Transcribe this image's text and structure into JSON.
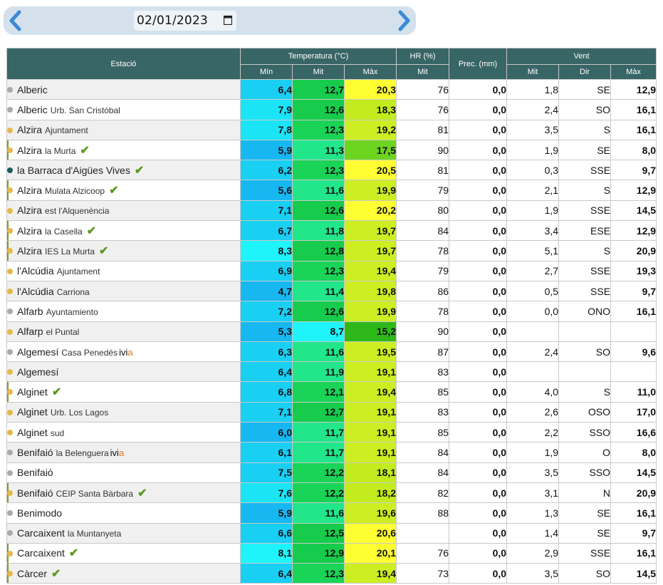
{
  "date": {
    "value": "02/01/2023"
  },
  "colors": {
    "header": "#386565",
    "dot_yellow": "#e6b84a",
    "dot_gray": "#aaaaaa",
    "dot_teal": "#1a5c5c",
    "check": "#5a9a1e",
    "ivia_a": "#e07a20"
  },
  "headers": {
    "estacio": "Estació",
    "temperatura": "Temperatura (°C)",
    "hr": "HR (%)",
    "prec": "Prec. (mm)",
    "vent": "Vent",
    "tmin": "Mín",
    "tmit": "Mit",
    "tmax": "Màx",
    "hrmit": "Mit",
    "vmit": "Mit",
    "vdir": "Dir",
    "vmax": "Màx"
  },
  "rows": [
    {
      "name": "Alberic",
      "sub": "",
      "dot": "gray",
      "check": false,
      "ivia": false,
      "flag": false,
      "tmin": "6,4",
      "tmit": "12,7",
      "tmax": "20,3",
      "hr": "76",
      "prec": "0,0",
      "vmit": "1,8",
      "dir": "SE",
      "vmax": "12,9",
      "cmin": "#19cff4",
      "cmit": "#17cc4c",
      "cmax": "#ffff33"
    },
    {
      "name": "Alberic",
      "sub": "Urb. San Cristóbal",
      "dot": "gray",
      "check": false,
      "ivia": false,
      "flag": false,
      "tmin": "7,9",
      "tmit": "12,6",
      "tmax": "18,3",
      "hr": "76",
      "prec": "0,0",
      "vmit": "2,4",
      "dir": "SO",
      "vmax": "16,1",
      "cmin": "#1be4f7",
      "cmit": "#17cc4c",
      "cmax": "#c3ec1f"
    },
    {
      "name": "Alzira",
      "sub": "Ajuntament",
      "dot": "yellow",
      "check": false,
      "ivia": false,
      "flag": false,
      "tmin": "7,8",
      "tmit": "12,3",
      "tmax": "19,2",
      "hr": "81",
      "prec": "0,0",
      "vmit": "3,5",
      "dir": "S",
      "vmax": "16,1",
      "cmin": "#1be4f7",
      "cmit": "#1ad458",
      "cmax": "#cdee22"
    },
    {
      "name": "Alzira",
      "sub": "la Murta",
      "dot": "yellow",
      "check": true,
      "ivia": false,
      "flag": true,
      "tmin": "5,9",
      "tmit": "11,3",
      "tmax": "17,5",
      "hr": "90",
      "prec": "0,0",
      "vmit": "1,9",
      "dir": "SE",
      "vmax": "8,0",
      "cmin": "#17b8f2",
      "cmit": "#22e68a",
      "cmax": "#6dd420"
    },
    {
      "name": "la Barraca d'Aigües Vives",
      "sub": "",
      "dot": "teal",
      "check": true,
      "ivia": false,
      "flag": false,
      "tmin": "6,2",
      "tmit": "12,3",
      "tmax": "20,5",
      "hr": "81",
      "prec": "0,0",
      "vmit": "0,3",
      "dir": "SSE",
      "vmax": "9,7",
      "cmin": "#19cff4",
      "cmit": "#1ad458",
      "cmax": "#ffff33"
    },
    {
      "name": "Alzira",
      "sub": "Mulata Alzicoop",
      "dot": "yellow",
      "check": true,
      "ivia": false,
      "flag": true,
      "tmin": "5,6",
      "tmit": "11,6",
      "tmax": "19,9",
      "hr": "79",
      "prec": "0,0",
      "vmit": "2,1",
      "dir": "S",
      "vmax": "12,9",
      "cmin": "#17b8f2",
      "cmit": "#22e68a",
      "cmax": "#cdee22"
    },
    {
      "name": "Alzira",
      "sub": "est l'Alquenència",
      "dot": "yellow",
      "check": false,
      "ivia": false,
      "flag": false,
      "tmin": "7,1",
      "tmit": "12,6",
      "tmax": "20,2",
      "hr": "80",
      "prec": "0,0",
      "vmit": "1,9",
      "dir": "SSE",
      "vmax": "14,5",
      "cmin": "#19cff4",
      "cmit": "#17cc4c",
      "cmax": "#ffff33"
    },
    {
      "name": "Alzira",
      "sub": "la Casella",
      "dot": "yellow",
      "check": true,
      "ivia": false,
      "flag": true,
      "tmin": "6,7",
      "tmit": "11,8",
      "tmax": "19,7",
      "hr": "84",
      "prec": "0,0",
      "vmit": "3,4",
      "dir": "ESE",
      "vmax": "12,9",
      "cmin": "#19cff4",
      "cmit": "#22e68a",
      "cmax": "#cdee22"
    },
    {
      "name": "Alzira",
      "sub": "IES La Murta",
      "dot": "yellow",
      "check": true,
      "ivia": false,
      "flag": true,
      "tmin": "8,3",
      "tmit": "12,8",
      "tmax": "19,7",
      "hr": "78",
      "prec": "0,0",
      "vmit": "5,1",
      "dir": "S",
      "vmax": "20,9",
      "cmin": "#1ff4fa",
      "cmit": "#17cc4c",
      "cmax": "#cdee22"
    },
    {
      "name": "l'Alcúdia",
      "sub": "Ajuntament",
      "dot": "yellow",
      "check": false,
      "ivia": false,
      "flag": false,
      "tmin": "6,9",
      "tmit": "12,3",
      "tmax": "19,4",
      "hr": "79",
      "prec": "0,0",
      "vmit": "2,7",
      "dir": "SSE",
      "vmax": "19,3",
      "cmin": "#19cff4",
      "cmit": "#1ad458",
      "cmax": "#cdee22"
    },
    {
      "name": "l'Alcúdia",
      "sub": "Carriona",
      "dot": "yellow",
      "check": false,
      "ivia": false,
      "flag": false,
      "tmin": "4,7",
      "tmit": "11,4",
      "tmax": "19,8",
      "hr": "86",
      "prec": "0,0",
      "vmit": "0,5",
      "dir": "SSE",
      "vmax": "9,7",
      "cmin": "#17b8f2",
      "cmit": "#22e68a",
      "cmax": "#cdee22"
    },
    {
      "name": "Alfarb",
      "sub": "Ayuntamiento",
      "dot": "gray",
      "check": false,
      "ivia": false,
      "flag": false,
      "tmin": "7,2",
      "tmit": "12,6",
      "tmax": "19,9",
      "hr": "78",
      "prec": "0,0",
      "vmit": "0,0",
      "dir": "ONO",
      "vmax": "16,1",
      "cmin": "#19cff4",
      "cmit": "#17cc4c",
      "cmax": "#cdee22"
    },
    {
      "name": "Alfarp",
      "sub": "el Puntal",
      "dot": "yellow",
      "check": false,
      "ivia": false,
      "flag": false,
      "tmin": "5,3",
      "tmit": "8,7",
      "tmax": "15,2",
      "hr": "90",
      "prec": "0,0",
      "vmit": "",
      "dir": "",
      "vmax": "",
      "cmin": "#17b8f2",
      "cmit": "#1ff4fa",
      "cmax": "#2eb81a"
    },
    {
      "name": "Algemesí",
      "sub": "Casa Penedés",
      "dot": "gray",
      "check": false,
      "ivia": true,
      "flag": false,
      "tmin": "6,3",
      "tmit": "11,6",
      "tmax": "19,5",
      "hr": "87",
      "prec": "0,0",
      "vmit": "2,4",
      "dir": "SO",
      "vmax": "9,6",
      "cmin": "#19cff4",
      "cmit": "#22e68a",
      "cmax": "#cdee22"
    },
    {
      "name": "Algemesí",
      "sub": "",
      "dot": "yellow",
      "check": false,
      "ivia": false,
      "flag": false,
      "tmin": "6,4",
      "tmit": "11,9",
      "tmax": "19,1",
      "hr": "83",
      "prec": "0,0",
      "vmit": "",
      "dir": "",
      "vmax": "",
      "cmin": "#19cff4",
      "cmit": "#22e68a",
      "cmax": "#cdee22"
    },
    {
      "name": "Alginet",
      "sub": "",
      "dot": "yellow",
      "check": true,
      "ivia": false,
      "flag": true,
      "tmin": "6,8",
      "tmit": "12,1",
      "tmax": "19,4",
      "hr": "85",
      "prec": "0,0",
      "vmit": "4,0",
      "dir": "S",
      "vmax": "11,0",
      "cmin": "#19cff4",
      "cmit": "#1ad458",
      "cmax": "#cdee22"
    },
    {
      "name": "Alginet",
      "sub": "Urb. Los Lagos",
      "dot": "yellow",
      "check": false,
      "ivia": false,
      "flag": false,
      "tmin": "7,1",
      "tmit": "12,7",
      "tmax": "19,1",
      "hr": "83",
      "prec": "0,0",
      "vmit": "2,6",
      "dir": "OSO",
      "vmax": "17,0",
      "cmin": "#19cff4",
      "cmit": "#17cc4c",
      "cmax": "#cdee22"
    },
    {
      "name": "Alginet",
      "sub": "sud",
      "dot": "yellow",
      "check": false,
      "ivia": false,
      "flag": false,
      "tmin": "6,0",
      "tmit": "11,7",
      "tmax": "19,1",
      "hr": "85",
      "prec": "0,0",
      "vmit": "2,2",
      "dir": "SSO",
      "vmax": "16,6",
      "cmin": "#17b8f2",
      "cmit": "#22e68a",
      "cmax": "#cdee22"
    },
    {
      "name": "Benifaió",
      "sub": "la Belenguera",
      "dot": "gray",
      "check": false,
      "ivia": true,
      "flag": false,
      "tmin": "6,1",
      "tmit": "11,7",
      "tmax": "19,1",
      "hr": "84",
      "prec": "0,0",
      "vmit": "1,9",
      "dir": "O",
      "vmax": "8,0",
      "cmin": "#19cff4",
      "cmit": "#22e68a",
      "cmax": "#cdee22"
    },
    {
      "name": "Benifaió",
      "sub": "",
      "dot": "gray",
      "check": false,
      "ivia": false,
      "flag": false,
      "tmin": "7,5",
      "tmit": "12,2",
      "tmax": "18,1",
      "hr": "84",
      "prec": "0,0",
      "vmit": "3,5",
      "dir": "SSO",
      "vmax": "14,5",
      "cmin": "#19cff4",
      "cmit": "#1ad458",
      "cmax": "#c3ec1f"
    },
    {
      "name": "Benifaió",
      "sub": "CEIP Santa Bàrbara",
      "dot": "yellow",
      "check": true,
      "ivia": false,
      "flag": true,
      "tmin": "7,6",
      "tmit": "12,2",
      "tmax": "18,2",
      "hr": "82",
      "prec": "0,0",
      "vmit": "3,1",
      "dir": "N",
      "vmax": "20,9",
      "cmin": "#1be4f7",
      "cmit": "#1ad458",
      "cmax": "#c3ec1f"
    },
    {
      "name": "Benimodo",
      "sub": "",
      "dot": "gray",
      "check": false,
      "ivia": false,
      "flag": false,
      "tmin": "5,9",
      "tmit": "11,6",
      "tmax": "19,6",
      "hr": "88",
      "prec": "0,0",
      "vmit": "1,3",
      "dir": "SE",
      "vmax": "16,1",
      "cmin": "#17b8f2",
      "cmit": "#22e68a",
      "cmax": "#cdee22"
    },
    {
      "name": "Carcaixent",
      "sub": "la Muntanyeta",
      "dot": "gray",
      "check": false,
      "ivia": false,
      "flag": false,
      "tmin": "6,6",
      "tmit": "12,5",
      "tmax": "20,6",
      "hr": "",
      "prec": "0,0",
      "vmit": "1,4",
      "dir": "SE",
      "vmax": "9,7",
      "cmin": "#19cff4",
      "cmit": "#17cc4c",
      "cmax": "#ffff33"
    },
    {
      "name": "Carcaixent",
      "sub": "",
      "dot": "yellow",
      "check": true,
      "ivia": false,
      "flag": true,
      "tmin": "8,1",
      "tmit": "12,9",
      "tmax": "20,1",
      "hr": "76",
      "prec": "0,0",
      "vmit": "2,9",
      "dir": "SSE",
      "vmax": "16,1",
      "cmin": "#1ff4fa",
      "cmit": "#17cc4c",
      "cmax": "#ffff33"
    },
    {
      "name": "Càrcer",
      "sub": "",
      "dot": "yellow",
      "check": true,
      "ivia": false,
      "flag": true,
      "tmin": "6,4",
      "tmit": "12,3",
      "tmax": "19,4",
      "hr": "73",
      "prec": "0,0",
      "vmit": "3,5",
      "dir": "SO",
      "vmax": "14,5",
      "cmin": "#19cff4",
      "cmit": "#1ad458",
      "cmax": "#cdee22"
    }
  ],
  "ivia_label": {
    "pre": "ivi",
    "post": "a"
  }
}
